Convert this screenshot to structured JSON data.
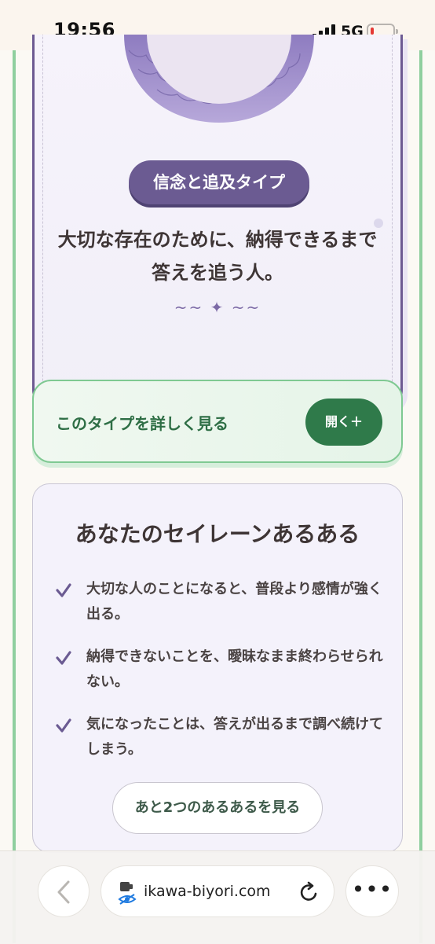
{
  "status_bar": {
    "time": "19:56",
    "network": "5G"
  },
  "result": {
    "type_name": "信念と追及タイプ",
    "description": "大切な存在のために、納得できるまで答えを追う人。",
    "flourish": "~~ ✦ ~~"
  },
  "detail": {
    "label": "このタイプを詳しく見る",
    "open_label": "開く＋"
  },
  "aruaru": {
    "title": "あなたのセイレーンあるある",
    "items": [
      "大切な人のことになると、普段より感情が強く出る。",
      "納得できないことを、曖昧なまま終わらせられない。",
      "気になったことは、答えが出るまで調べ続けてしまう。"
    ],
    "more_label": "あと2つのあるあるを見る"
  },
  "browser": {
    "url": "ikawa-biyori.com"
  },
  "colors": {
    "accent_purple": "#6b5b92",
    "accent_green": "#2f7a4a",
    "rail_green": "#8fcf9f"
  }
}
